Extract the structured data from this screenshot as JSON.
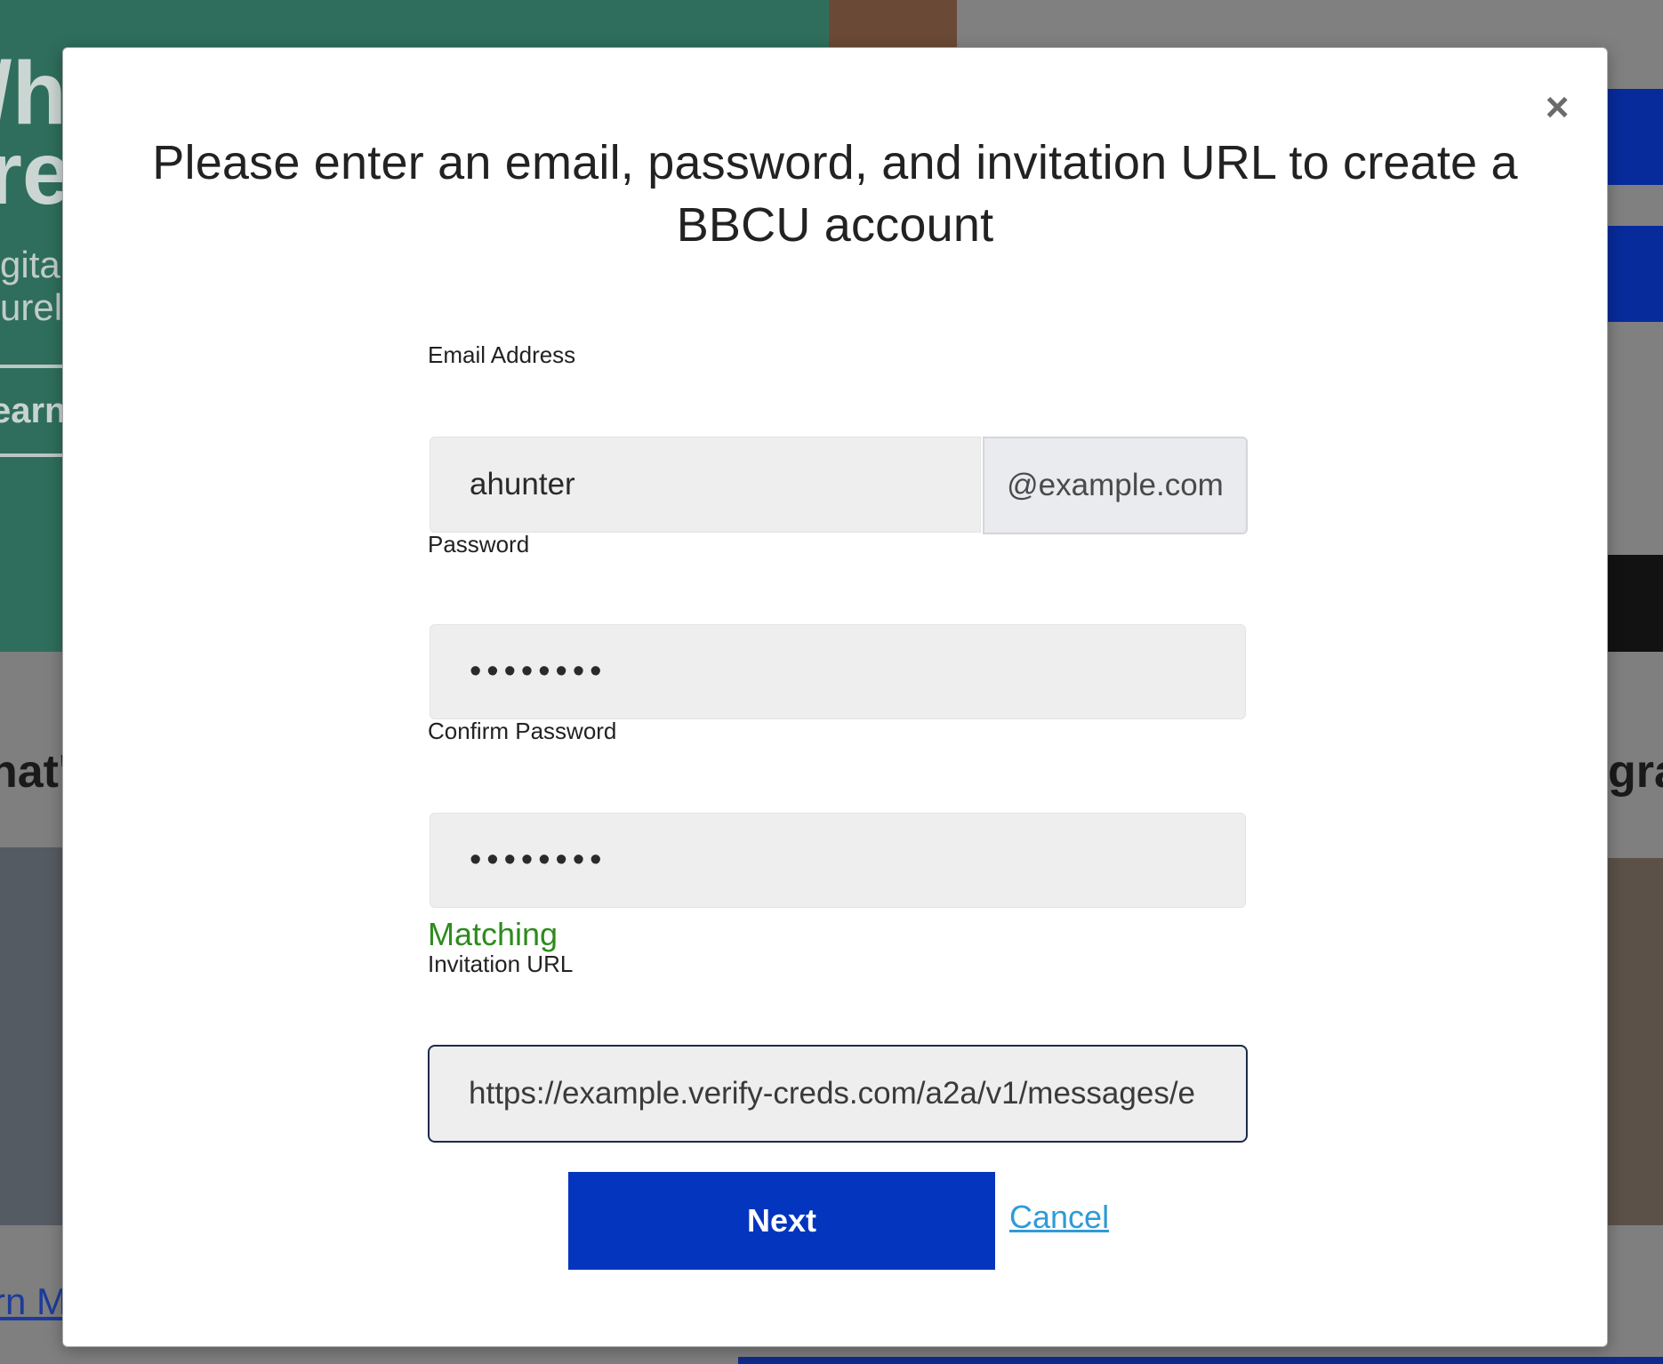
{
  "background": {
    "hero_heading": "/h\nre",
    "hero_sub": "gital\nurely",
    "hero_link": "earn",
    "section_left": "nat'",
    "section_right": "gra",
    "bottom_link": "rn M"
  },
  "modal": {
    "close_symbol": "×",
    "title": "Please enter an email, password, and invitation URL to create a BBCU account",
    "email": {
      "label": "Email Address",
      "value": "ahunter",
      "suffix": "@example.com"
    },
    "password": {
      "label": "Password",
      "value": "••••••••"
    },
    "confirm_password": {
      "label": "Confirm Password",
      "value": "••••••••",
      "status": "Matching"
    },
    "invitation_url": {
      "label": "Invitation URL",
      "value": "https://example.verify-creds.com/a2a/v1/messages/e"
    },
    "next_label": "Next",
    "cancel_label": "Cancel"
  },
  "colors": {
    "primary": "#0435be",
    "success": "#2e8b1d",
    "link": "#2f9bd8",
    "hero_green": "#2f6e5c"
  }
}
